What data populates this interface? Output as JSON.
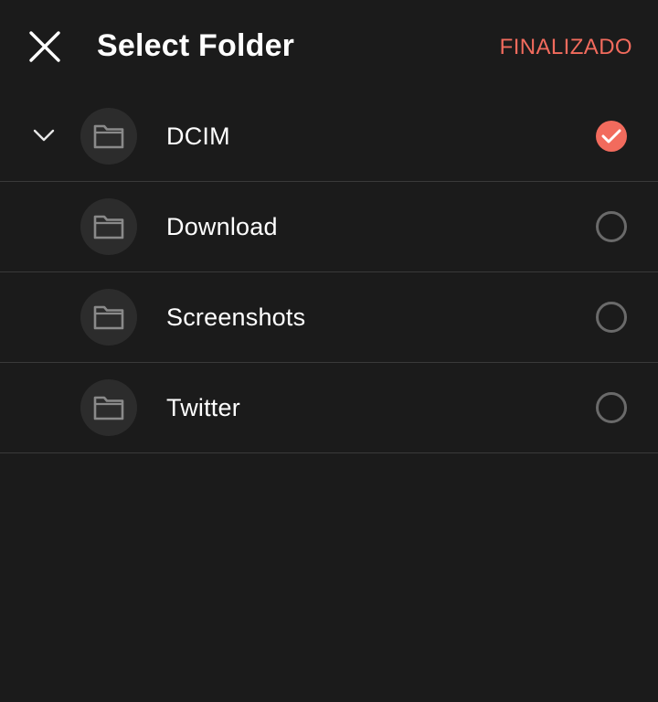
{
  "header": {
    "title": "Select Folder",
    "done_label": "FINALIZADO"
  },
  "colors": {
    "background": "#1b1b1b",
    "accent": "#f26b5d",
    "divider": "#3a3a3a",
    "folder_circle": "#2c2c2c"
  },
  "folders": [
    {
      "name": "DCIM",
      "expanded": true,
      "selected": true
    },
    {
      "name": "Download",
      "expanded": false,
      "selected": false
    },
    {
      "name": "Screenshots",
      "expanded": false,
      "selected": false
    },
    {
      "name": "Twitter",
      "expanded": false,
      "selected": false
    }
  ]
}
